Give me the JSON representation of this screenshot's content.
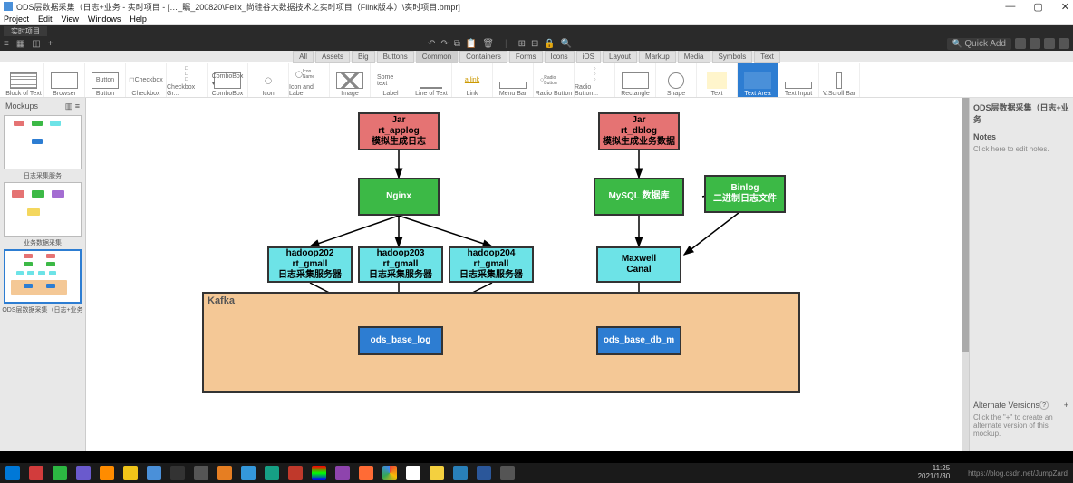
{
  "window": {
    "title": "ODS层数据采集（日志+业务 - 实时项目 - […_瞩_200820\\Felix_尚硅谷大数据技术之实时项目（Flink版本）\\实时项目.bmpr]"
  },
  "menu": {
    "project": "Project",
    "edit": "Edit",
    "view": "View",
    "windows": "Windows",
    "help": "Help"
  },
  "tab": {
    "active": "实时项目"
  },
  "quickadd": {
    "label": "Quick Add"
  },
  "filters": {
    "all": "All",
    "assets": "Assets",
    "big": "Big",
    "buttons": "Buttons",
    "common": "Common",
    "containers": "Containers",
    "forms": "Forms",
    "icons": "Icons",
    "ios": "iOS",
    "layout": "Layout",
    "markup": "Markup",
    "media": "Media",
    "symbols": "Symbols",
    "text": "Text"
  },
  "widgets": {
    "blocktext": "Block of Text",
    "browser": "Browser",
    "button": "Button",
    "checkbox": "Checkbox",
    "checkboxgroup": "Checkbox Gr...",
    "combobox": "ComboBox",
    "icon": "Icon",
    "iconlabel": "Icon and Label",
    "image": "Image",
    "label": "Label",
    "lineoftext": "Line of Text",
    "link": "Link",
    "menubar": "Menu Bar",
    "radiobutton": "Radio Button",
    "radiobuttongr": "Radio Button...",
    "rectangle": "Rectangle",
    "shape": "Shape",
    "text": "Text",
    "textarea": "Text Area",
    "textinput": "Text Input",
    "vscroll": "V.Scroll Bar",
    "button_label": "Button",
    "checkbox_label": "Checkbox",
    "combo_label": "ComboBox ▾",
    "label_txt": "Some text",
    "link_txt": "a link",
    "radio_txt": "Radio Button",
    "icon_name": "Icon Name"
  },
  "sidebar_left": {
    "header": "Mockups",
    "thumbs": [
      "日志采集服务",
      "业务数据采集",
      "ODS层数据采集（日志+业务"
    ]
  },
  "canvas": {
    "jar_applog": {
      "l1": "Jar",
      "l2": "rt_applog",
      "l3": "模拟生成日志"
    },
    "jar_dblog": {
      "l1": "Jar",
      "l2": "rt_dblog",
      "l3": "模拟生成业务数据"
    },
    "nginx": "Nginx",
    "mysql": "MySQL 数据库",
    "binlog": {
      "l1": "Binlog",
      "l2": "二进制日志文件"
    },
    "hadoop202": {
      "l1": "hadoop202",
      "l2": "rt_gmall",
      "l3": "日志采集服务器"
    },
    "hadoop203": {
      "l1": "hadoop203",
      "l2": "rt_gmall",
      "l3": "日志采集服务器"
    },
    "hadoop204": {
      "l1": "hadoop204",
      "l2": "rt_gmall",
      "l3": "日志采集服务器"
    },
    "maxwell": {
      "l1": "Maxwell",
      "l2": "Canal"
    },
    "kafka": "Kafka",
    "ods_log": "ods_base_log",
    "ods_db": "ods_base_db_m"
  },
  "sidebar_right": {
    "title": "ODS层数据采集（日志+业务",
    "notes_label": "Notes",
    "notes_placeholder": "Click here to edit notes.",
    "alt_label": "Alternate Versions",
    "alt_hint": "Click the \"+\" to create an alternate version of this mockup."
  },
  "clock": {
    "time": "11:25",
    "date": "2021/1/30"
  },
  "watermark": "https://blog.csdn.net/JumpZard"
}
